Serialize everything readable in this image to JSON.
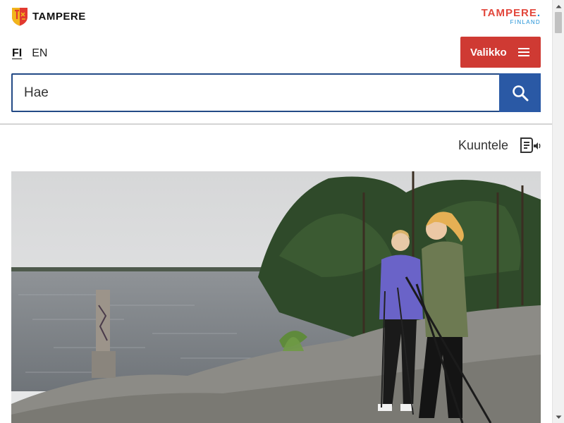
{
  "header": {
    "logo_text": "TAMPERE",
    "brand_main": "TAMPERE",
    "brand_dot": ".",
    "brand_sub": "FINLAND"
  },
  "language": {
    "active": "FI",
    "inactive": "EN"
  },
  "menu": {
    "label": "Valikko",
    "icon": "hamburger-icon"
  },
  "search": {
    "placeholder": "Hae",
    "value": "",
    "icon": "search-icon"
  },
  "listen": {
    "label": "Kuuntele",
    "icon": "listen-speaker-icon"
  },
  "hero": {
    "icon": "hero-photo-lakeside-walkers"
  },
  "colors": {
    "menu_red": "#cf3a33",
    "search_blue": "#2a59a5",
    "search_border": "#234a86",
    "brand_red": "#e2473c",
    "brand_blue": "#1c8fd6"
  }
}
